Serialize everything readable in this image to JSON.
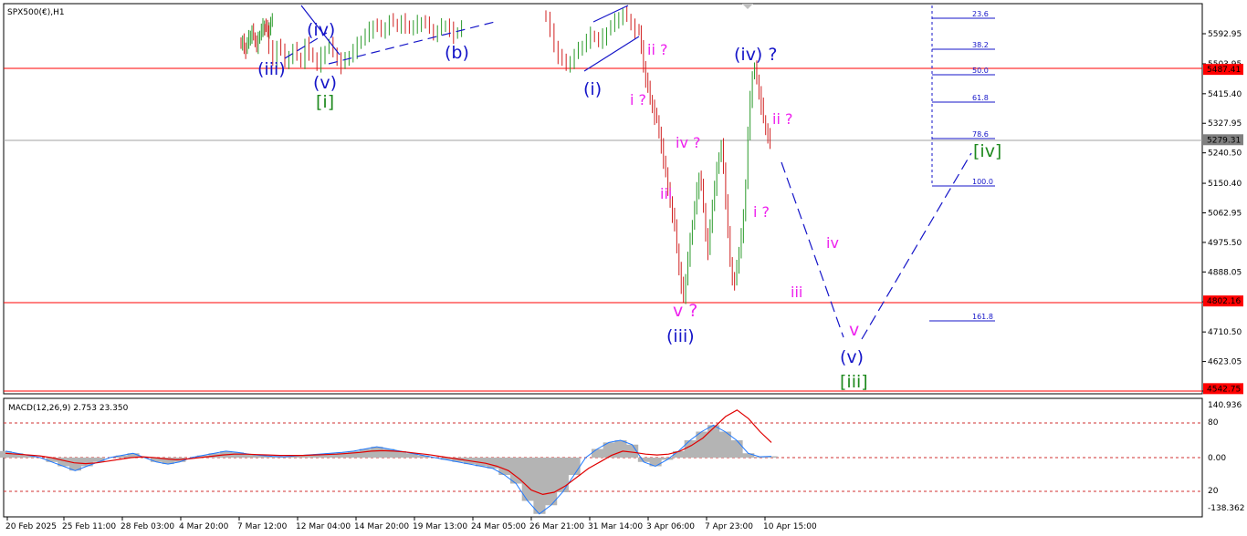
{
  "chart_data": [
    {
      "type": "candlestick",
      "title": "SPX500(€),H1",
      "y_labels": [
        "5592.95",
        "5503.95",
        "5415.40",
        "5327.95",
        "5240.50",
        "5150.40",
        "5062.95",
        "4975.50",
        "4888.05",
        "4799.60",
        "4710.50",
        "4623.05",
        "4535.60"
      ],
      "price_tags": [
        {
          "value": "5487.41",
          "color": "#ff0000"
        },
        {
          "value": "5279.31",
          "color": "#808080"
        },
        {
          "value": "4802.16",
          "color": "#ff0000"
        },
        {
          "value": "4542.75",
          "color": "#ff0000"
        }
      ],
      "x_labels": [
        "20 Feb 2025",
        "25 Feb 11:00",
        "28 Feb 03:00",
        "4 Mar 20:00",
        "7 Mar 12:00",
        "12 Mar 04:00",
        "14 Mar 20:00",
        "19 Mar 13:00",
        "24 Mar 05:00",
        "26 Mar 21:00",
        "31 Mar 14:00",
        "3 Apr 06:00",
        "7 Apr 23:00",
        "10 Apr 15:00"
      ],
      "fib_levels": [
        "23.6",
        "38.2",
        "50.0",
        "61.8",
        "78.6",
        "100.0",
        "161.8"
      ],
      "wave_labels": [
        {
          "text": "(iii)",
          "color": "#1515c8"
        },
        {
          "text": "(iv)",
          "color": "#1515c8"
        },
        {
          "text": "(v)",
          "color": "#1515c8"
        },
        {
          "text": "[i]",
          "color": "#1f8a1f"
        },
        {
          "text": "(b)",
          "color": "#1515c8"
        },
        {
          "text": "(i)",
          "color": "#1515c8"
        },
        {
          "text": "ii ?",
          "color": "#ee22ee"
        },
        {
          "text": "i ?",
          "color": "#ee22ee"
        },
        {
          "text": "iv ?",
          "color": "#ee22ee"
        },
        {
          "text": "iii",
          "color": "#ee22ee"
        },
        {
          "text": "v ?",
          "color": "#ee22ee"
        },
        {
          "text": "(iii)",
          "color": "#1515c8"
        },
        {
          "text": "(iv) ?",
          "color": "#1515c8"
        },
        {
          "text": "ii ?",
          "color": "#ee22ee"
        },
        {
          "text": "i ?",
          "color": "#ee22ee"
        },
        {
          "text": "iv",
          "color": "#ee22ee"
        },
        {
          "text": "iii",
          "color": "#ee22ee"
        },
        {
          "text": "v",
          "color": "#ee22ee"
        },
        {
          "text": "(v)",
          "color": "#1515c8"
        },
        {
          "text": "[iii]",
          "color": "#1f8a1f"
        },
        {
          "text": "[iv]",
          "color": "#1f8a1f"
        }
      ],
      "series": [
        {
          "name": "",
          "close": [
            5560,
            5570,
            5555,
            5545,
            5565,
            5580,
            5590,
            5600,
            5585,
            5570,
            5560,
            5575,
            5590,
            5605,
            5615,
            5620,
            5610,
            5600,
            5615,
            5625,
            5630
          ]
        },
        {
          "name": "",
          "close": [
            5600,
            5550,
            5520,
            5560,
            5540,
            5510,
            5530,
            5545,
            5525,
            5510,
            5560,
            5540,
            5520,
            5500,
            5530,
            5545,
            5560,
            5540,
            5520,
            5500,
            5515,
            5530,
            5545,
            5560,
            5575,
            5590,
            5605,
            5620,
            5610,
            5600,
            5615,
            5630,
            5625,
            5615,
            5630,
            5620,
            5605,
            5615,
            5625,
            5630,
            5620,
            5610,
            5595,
            5600,
            5615,
            5620,
            5605,
            5590,
            5600,
            5615
          ]
        },
        {
          "name": "",
          "close": [
            5640,
            5600,
            5560,
            5530,
            5510,
            5500,
            5515,
            5530,
            5545,
            5560,
            5575,
            5590,
            5580,
            5570,
            5585,
            5600,
            5615,
            5630,
            5645,
            5650,
            5640,
            5620,
            5600
          ]
        },
        {
          "name": "",
          "close": [
            5600,
            5550,
            5500,
            5460,
            5430,
            5400,
            5380,
            5350,
            5340,
            5300,
            5260,
            5220,
            5180,
            5130,
            5100,
            5060,
            5020,
            4960,
            4900,
            4850,
            4810,
            4870,
            4930,
            4980,
            5030,
            5080,
            5130,
            5170,
            5140,
            5080,
            5000,
            4950,
            5020,
            5090,
            5140,
            5190,
            5230,
            5260,
            5200,
            5100,
            5000,
            4920,
            4870,
            4860,
            4900,
            4950,
            5000,
            5050,
            5150,
            5300,
            5400,
            5470,
            5490,
            5460,
            5420,
            5380,
            5340,
            5310,
            5290,
            5279
          ]
        }
      ]
    },
    {
      "type": "line",
      "title": "MACD(12,26,9) 2.753 23.350",
      "y_labels": [
        "140.936",
        "80",
        "0.00",
        "20",
        "-138.362"
      ],
      "series": [
        {
          "name": "",
          "values": [
            15,
            10,
            5,
            0,
            -10,
            -20,
            -30,
            -20,
            -10,
            0,
            5,
            10,
            0,
            -10,
            -15,
            -10,
            0,
            5,
            10,
            15,
            12,
            8,
            5,
            3,
            2,
            4,
            6,
            8,
            10,
            12,
            15,
            20,
            25,
            20,
            15,
            10,
            5,
            0,
            -5,
            -10,
            -15,
            -20,
            -25,
            -40,
            -60,
            -100,
            -130,
            -110,
            -80,
            -40,
            0,
            20,
            35,
            40,
            30,
            -10,
            -20,
            -5,
            15,
            40,
            60,
            75,
            60,
            40,
            10,
            2,
            3
          ]
        },
        {
          "name": "",
          "values": [
            10,
            8,
            6,
            4,
            0,
            -6,
            -12,
            -14,
            -12,
            -8,
            -4,
            0,
            2,
            0,
            -3,
            -5,
            -3,
            0,
            3,
            6,
            8,
            8,
            7,
            6,
            5,
            5,
            5,
            6,
            7,
            8,
            10,
            12,
            15,
            16,
            15,
            13,
            10,
            7,
            3,
            -1,
            -5,
            -9,
            -13,
            -20,
            -30,
            -50,
            -75,
            -85,
            -80,
            -65,
            -45,
            -25,
            -10,
            5,
            15,
            12,
            8,
            6,
            8,
            15,
            28,
            45,
            70,
            95,
            110,
            90,
            60,
            35
          ]
        }
      ]
    }
  ]
}
